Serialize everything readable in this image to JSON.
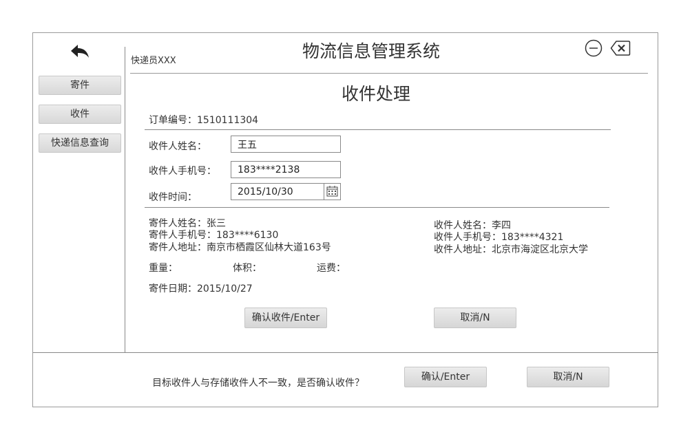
{
  "app": {
    "title": "物流信息管理系统",
    "user": "快递员XXX"
  },
  "sidebar": {
    "items": [
      {
        "label": "寄件"
      },
      {
        "label": "收件"
      },
      {
        "label": "快递信息查询"
      }
    ]
  },
  "page": {
    "title": "收件处理"
  },
  "order": {
    "label": "订单编号：1510111304"
  },
  "form": {
    "name_label": "收件人姓名：",
    "name_value": "王五",
    "phone_label": "收件人手机号：",
    "phone_value": "183****2138",
    "time_label": "收件时间：",
    "time_value": "2015/10/30"
  },
  "sender": {
    "name": "寄件人姓名：张三",
    "phone": "寄件人手机号：183****6130",
    "address": "寄件人地址：南京市栖霞区仙林大道163号"
  },
  "receiver": {
    "name": "收件人姓名：李四",
    "phone": "收件人手机号：183****4321",
    "address": "收件人地址：北京市海淀区北京大学"
  },
  "package": {
    "weight_label": "重量：",
    "volume_label": "体积：",
    "fee_label": "运费：",
    "date": "寄件日期：2015/10/27"
  },
  "actions": {
    "confirm": "确认收件/Enter",
    "cancel": "取消/N"
  },
  "dialog": {
    "message": "目标收件人与存储收件人不一致，是否确认收件？",
    "confirm": "确认/Enter",
    "cancel": "取消/N"
  }
}
